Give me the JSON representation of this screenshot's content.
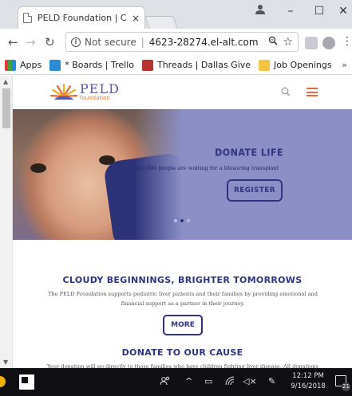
{
  "browser": {
    "tab_title": "PELD Foundation | Cloud",
    "tab_close": "×",
    "window_controls": {
      "minimize": "–",
      "maximize": "☐",
      "close": "✕"
    },
    "omnibox": {
      "security_label": "Not secure",
      "separator": "|",
      "url": "4623-28274.el-alt.com"
    },
    "bookmarks": [
      {
        "label": "Apps"
      },
      {
        "label": "* Boards | Trello"
      },
      {
        "label": "Threads | Dallas Give"
      },
      {
        "label": "Job Openings"
      }
    ],
    "bookmarks_more": "»"
  },
  "site": {
    "logo": {
      "name": "PELD",
      "sub": "foundation"
    },
    "hero": {
      "title": "DONATE LIFE",
      "subtitle": "115,000 people are waiting for a lifesaving transplant",
      "button": "REGISTER",
      "slide_count": 3,
      "active_slide": 2
    },
    "cloudy": {
      "title": "CLOUDY BEGINNINGS, BRIGHTER TOMORROWS",
      "text": "The PELD Foundation supports pediatric liver patients and their families by providing emotional and financial support as a partner in their journey.",
      "button": "MORE"
    },
    "donate": {
      "title": "DONATE TO OUR CAUSE",
      "text": "Your donation will go directly to those families who have children fighting liver disease. All donations"
    }
  },
  "taskbar": {
    "time": "12:12 PM",
    "date": "9/16/2018",
    "notifications": "21"
  },
  "colors": {
    "brand_navy": "#2e3481",
    "hero_bg": "#8b8fc6",
    "accent_orange": "#e86a3c"
  }
}
